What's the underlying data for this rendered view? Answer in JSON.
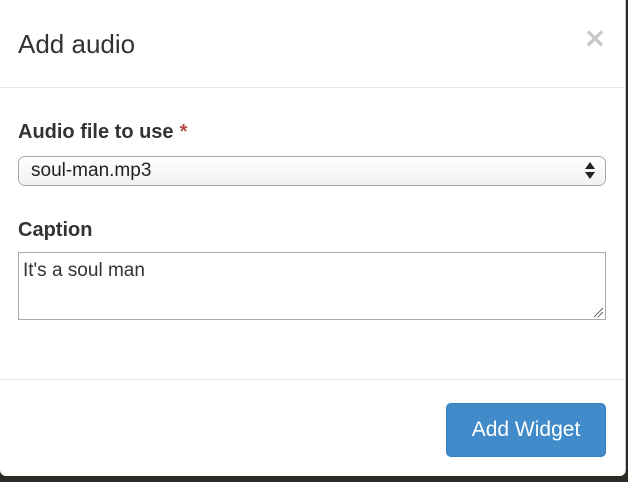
{
  "modal": {
    "title": "Add audio",
    "close_label": "×"
  },
  "form": {
    "audio_file": {
      "label": "Audio file to use",
      "required_mark": "*",
      "selected_value": "soul-man.mp3"
    },
    "caption": {
      "label": "Caption",
      "value": "It's a soul man"
    }
  },
  "footer": {
    "submit_label": "Add Widget"
  },
  "colors": {
    "primary": "#428bca",
    "required": "#b94a48",
    "close": "#c8c8c8"
  },
  "icons": {
    "close": "close-icon",
    "select": "select-arrows-icon",
    "resize": "resize-grip-icon"
  }
}
